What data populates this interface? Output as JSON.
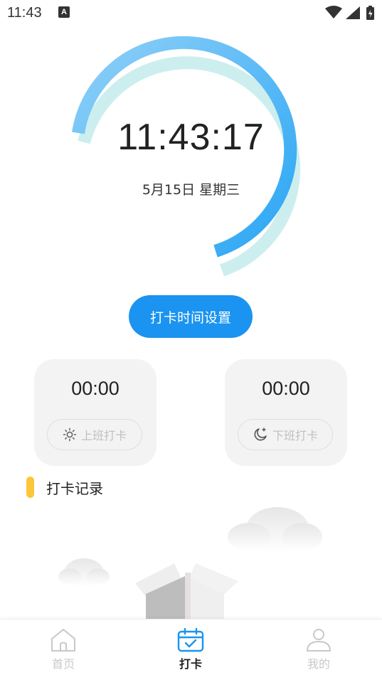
{
  "status_bar": {
    "time": "11:43",
    "notification_icon": "A",
    "icons": [
      "wifi-icon",
      "signal-icon",
      "battery-charging-icon"
    ]
  },
  "clock": {
    "time": "11:43:17",
    "date": "5月15日  星期三"
  },
  "settings_button": {
    "label": "打卡时间设置"
  },
  "punch_cards": [
    {
      "time": "00:00",
      "button_label": "上班打卡",
      "icon": "sun-icon"
    },
    {
      "time": "00:00",
      "button_label": "下班打卡",
      "icon": "moon-icon"
    }
  ],
  "records": {
    "title": "打卡记录"
  },
  "bottom_nav": {
    "items": [
      {
        "label": "首页",
        "icon": "home-icon",
        "active": false
      },
      {
        "label": "打卡",
        "icon": "calendar-check-icon",
        "active": true
      },
      {
        "label": "我的",
        "icon": "user-icon",
        "active": false
      }
    ]
  },
  "colors": {
    "accent": "#1a94f0",
    "ring_light": "#7cc8f6",
    "ring_shadow": "#cdeeee",
    "record_marker": "#fbc63b",
    "card_bg": "#f3f3f3"
  }
}
